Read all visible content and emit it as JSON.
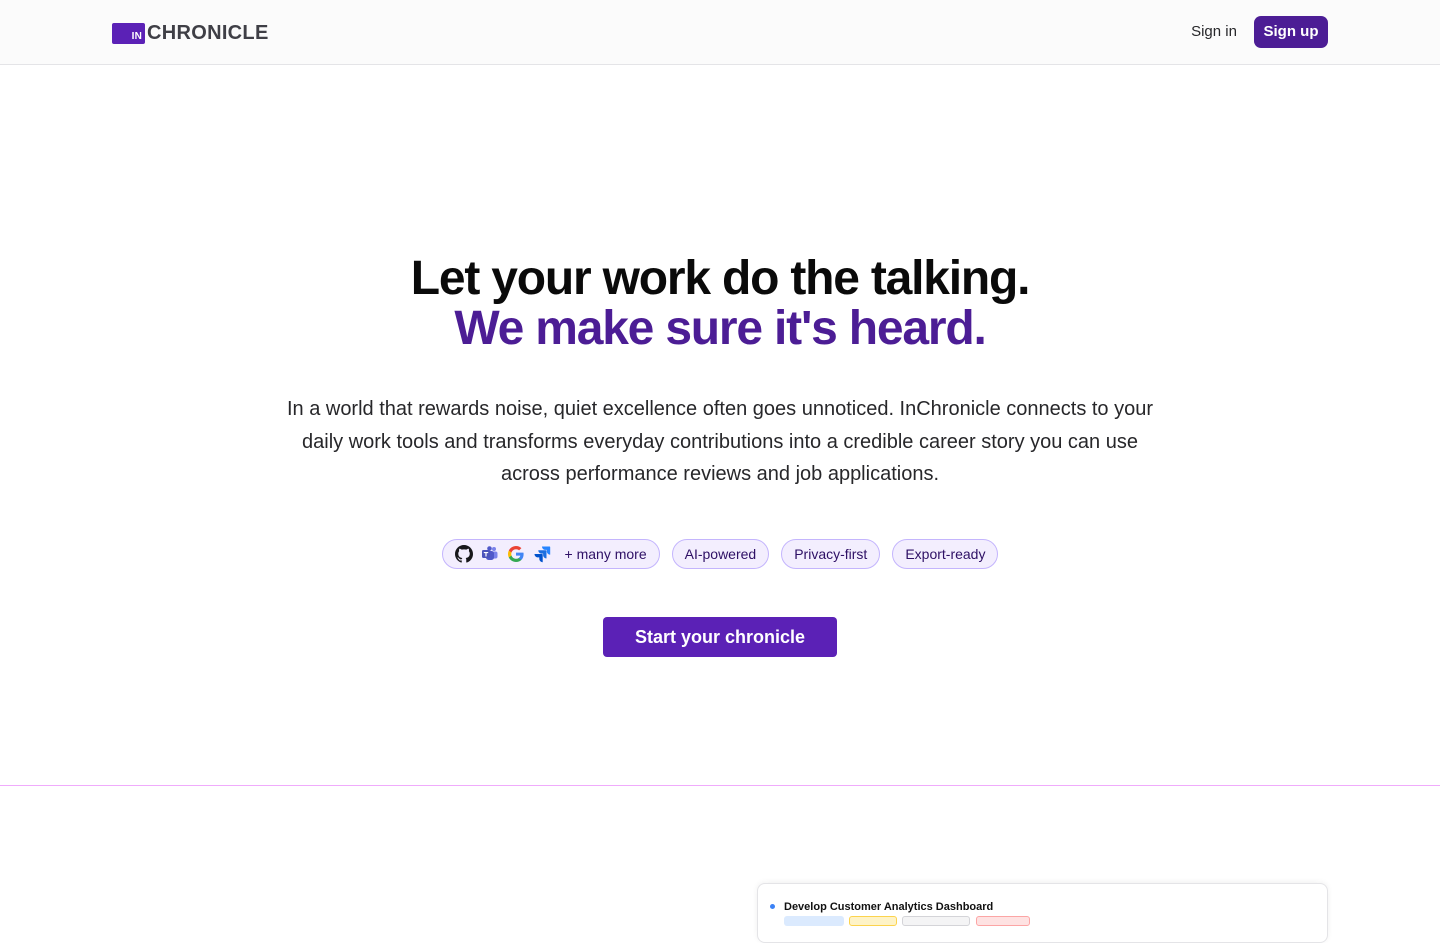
{
  "header": {
    "logo_mark": "IN",
    "logo_word": "CHRONICLE",
    "sign_in": "Sign in",
    "sign_up": "Sign up"
  },
  "hero": {
    "headline_line1": "Let your work do the talking.",
    "headline_line2": "We make sure it's heard.",
    "subtext": "In a world that rewards noise, quiet excellence often goes unnoticed. InChronicle connects to your daily work tools and transforms everyday contributions into a credible career story you can use across performance reviews and job applications.",
    "integrations": {
      "icons": [
        "github-icon",
        "teams-icon",
        "google-icon",
        "jira-icon"
      ],
      "label": "+ many more"
    },
    "badges": [
      "AI-powered",
      "Privacy-first",
      "Export-ready"
    ],
    "cta": "Start your chronicle"
  },
  "preview": {
    "task_title": "Develop Customer Analytics Dashboard"
  },
  "colors": {
    "brand": "#5b21b6",
    "brand_dark": "#4c1d95",
    "chip_bg": "#f3eefe",
    "chip_border": "#c4b5fd",
    "divider": "#f0abfc"
  }
}
